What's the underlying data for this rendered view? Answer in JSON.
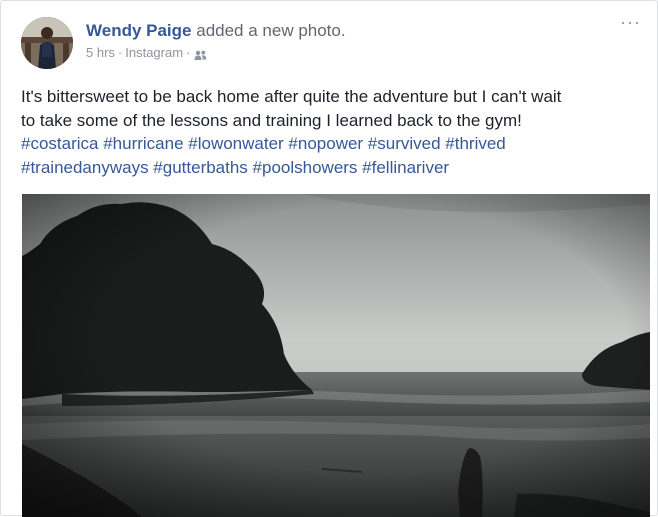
{
  "post": {
    "author": "Wendy Paige",
    "action": "added a new photo.",
    "time": "5 hrs",
    "source": "Instagram",
    "separator": "·",
    "audience_icon": "friends-icon",
    "more_icon": "more-options-icon",
    "more_glyph": "···",
    "message_line1": "It's bittersweet to be back home after quite the adventure but I can't wait",
    "message_line2": "to take some of the lessons and training I learned back to the gym!",
    "hashtags_line1": "#costarica #hurricane #lowonwater #nopower #survived #thrived",
    "hashtags_line2": "#trainedanyways #gutterbaths #poolshowers #fellinariver"
  },
  "colors": {
    "author_link": "#365899",
    "hashtag_link": "#365899",
    "secondary_text": "#90949c",
    "body_text": "#1d2129"
  }
}
